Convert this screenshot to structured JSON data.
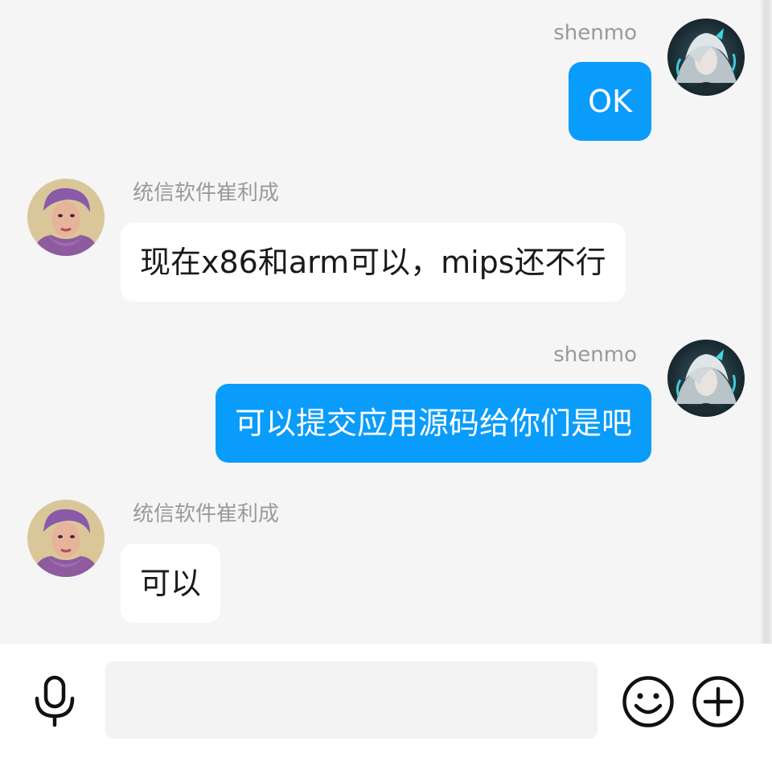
{
  "chat": {
    "messages": [
      {
        "sender": "shenmo",
        "side": "right",
        "text": "OK"
      },
      {
        "sender": "统信软件崔利成",
        "side": "left",
        "text": "现在x86和arm可以，mips还不行"
      },
      {
        "sender": "shenmo",
        "side": "right",
        "text": "可以提交应用源码给你们是吧"
      },
      {
        "sender": "统信软件崔利成",
        "side": "left",
        "text": "可以"
      }
    ]
  },
  "input_bar": {
    "message_value": "",
    "voice_icon": "microphone-icon",
    "emoji_icon": "smiley-icon",
    "more_icon": "plus-circle-icon"
  },
  "colors": {
    "outgoing_bubble": "#0a9cfb",
    "incoming_bubble": "#ffffff",
    "chat_background": "#f5f5f6",
    "sender_name": "#9a9a9a"
  }
}
